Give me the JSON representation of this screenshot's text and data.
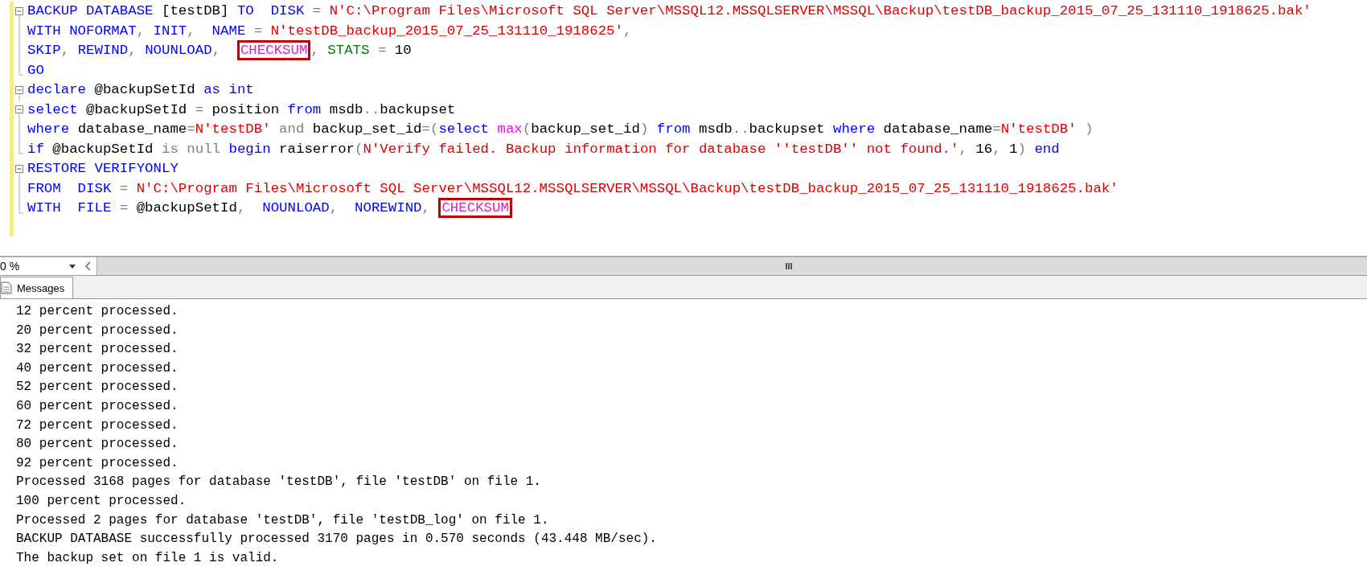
{
  "editor": {
    "lines": [
      {
        "kind": "block-start",
        "tokens": [
          {
            "kind": "kw",
            "text": "BACKUP DATABASE "
          },
          {
            "kind": "plain",
            "text": "[testDB] "
          },
          {
            "kind": "kw",
            "text": "TO  DISK "
          },
          {
            "kind": "op",
            "text": "= "
          },
          {
            "kind": "str",
            "text": "N'C:\\Program Files\\Microsoft SQL Server\\MSSQL12.MSSQLSERVER\\MSSQL\\Backup\\testDB_backup_2015_07_25_131110_1918625.bak'"
          }
        ]
      },
      {
        "kind": "block-body",
        "tokens": [
          {
            "kind": "kw",
            "text": "WITH NOFORMAT"
          },
          {
            "kind": "op",
            "text": ", "
          },
          {
            "kind": "kw",
            "text": "INIT"
          },
          {
            "kind": "op",
            "text": ",  "
          },
          {
            "kind": "kw",
            "text": "NAME "
          },
          {
            "kind": "op",
            "text": "= "
          },
          {
            "kind": "str",
            "text": "N'testDB_backup_2015_07_25_131110_1918625'"
          },
          {
            "kind": "op",
            "text": ","
          }
        ]
      },
      {
        "kind": "block-body",
        "tokens": [
          {
            "kind": "kw",
            "text": "SKIP"
          },
          {
            "kind": "op",
            "text": ", "
          },
          {
            "kind": "kw",
            "text": "REWIND"
          },
          {
            "kind": "op",
            "text": ", "
          },
          {
            "kind": "kw",
            "text": "NOUNLOAD"
          },
          {
            "kind": "op",
            "text": ",  "
          },
          {
            "kind": "fn",
            "text": "CHECKSUM",
            "boxed": true
          },
          {
            "kind": "op",
            "text": ", "
          },
          {
            "kind": "sys",
            "text": "STATS "
          },
          {
            "kind": "op",
            "text": "= "
          },
          {
            "kind": "plain",
            "text": "10"
          }
        ]
      },
      {
        "kind": "block-end",
        "tokens": [
          {
            "kind": "kw",
            "text": "GO"
          }
        ]
      },
      {
        "kind": "block-start",
        "tokens": [
          {
            "kind": "kw",
            "text": "declare "
          },
          {
            "kind": "plain",
            "text": "@backupSetId "
          },
          {
            "kind": "kw",
            "text": "as int"
          }
        ]
      },
      {
        "kind": "block-start",
        "tokens": [
          {
            "kind": "kw",
            "text": "select "
          },
          {
            "kind": "plain",
            "text": "@backupSetId "
          },
          {
            "kind": "op",
            "text": "= "
          },
          {
            "kind": "plain",
            "text": "position "
          },
          {
            "kind": "kw",
            "text": "from "
          },
          {
            "kind": "plain",
            "text": "msdb"
          },
          {
            "kind": "op",
            "text": ".."
          },
          {
            "kind": "plain",
            "text": "backupset"
          }
        ]
      },
      {
        "kind": "block-body",
        "tokens": [
          {
            "kind": "kw",
            "text": "where "
          },
          {
            "kind": "plain",
            "text": "database_name"
          },
          {
            "kind": "op",
            "text": "="
          },
          {
            "kind": "str",
            "text": "N'testDB'"
          },
          {
            "kind": "op",
            "text": " and "
          },
          {
            "kind": "plain",
            "text": "backup_set_id"
          },
          {
            "kind": "op",
            "text": "=("
          },
          {
            "kind": "kw",
            "text": "select "
          },
          {
            "kind": "fn",
            "text": "max"
          },
          {
            "kind": "op",
            "text": "("
          },
          {
            "kind": "plain",
            "text": "backup_set_id"
          },
          {
            "kind": "op",
            "text": ") "
          },
          {
            "kind": "kw",
            "text": "from "
          },
          {
            "kind": "plain",
            "text": "msdb"
          },
          {
            "kind": "op",
            "text": ".."
          },
          {
            "kind": "plain",
            "text": "backupset "
          },
          {
            "kind": "kw",
            "text": "where "
          },
          {
            "kind": "plain",
            "text": "database_name"
          },
          {
            "kind": "op",
            "text": "="
          },
          {
            "kind": "str",
            "text": "N'testDB'"
          },
          {
            "kind": "op",
            "text": " )"
          }
        ]
      },
      {
        "kind": "block-end",
        "tokens": [
          {
            "kind": "kw",
            "text": "if "
          },
          {
            "kind": "plain",
            "text": "@backupSetId "
          },
          {
            "kind": "op",
            "text": "is null "
          },
          {
            "kind": "kw",
            "text": "begin "
          },
          {
            "kind": "plain",
            "text": "raiserror"
          },
          {
            "kind": "op",
            "text": "("
          },
          {
            "kind": "str",
            "text": "N'Verify failed. Backup information for database ''testDB'' not found.'"
          },
          {
            "kind": "op",
            "text": ", "
          },
          {
            "kind": "plain",
            "text": "16"
          },
          {
            "kind": "op",
            "text": ", "
          },
          {
            "kind": "plain",
            "text": "1"
          },
          {
            "kind": "op",
            "text": ") "
          },
          {
            "kind": "kw",
            "text": "end"
          }
        ]
      },
      {
        "kind": "block-start",
        "tokens": [
          {
            "kind": "kw",
            "text": "RESTORE VERIFYONLY"
          }
        ]
      },
      {
        "kind": "block-body",
        "tokens": [
          {
            "kind": "kw",
            "text": "FROM  DISK "
          },
          {
            "kind": "op",
            "text": "= "
          },
          {
            "kind": "str",
            "text": "N'C:\\Program Files\\Microsoft SQL Server\\MSSQL12.MSSQLSERVER\\MSSQL\\Backup\\testDB_backup_2015_07_25_131110_1918625.bak'"
          }
        ]
      },
      {
        "kind": "block-end",
        "tokens": [
          {
            "kind": "kw",
            "text": "WITH  FILE "
          },
          {
            "kind": "op",
            "text": "= "
          },
          {
            "kind": "plain",
            "text": "@backupSetId"
          },
          {
            "kind": "op",
            "text": ",  "
          },
          {
            "kind": "kw",
            "text": "NOUNLOAD"
          },
          {
            "kind": "op",
            "text": ",  "
          },
          {
            "kind": "kw",
            "text": "NOREWIND"
          },
          {
            "kind": "op",
            "text": ", "
          },
          {
            "kind": "fn",
            "text": "CHECKSUM",
            "boxed": true
          }
        ]
      }
    ]
  },
  "zoom": {
    "value": "0 %"
  },
  "tabs": [
    {
      "label": "Messages",
      "selected": true
    }
  ],
  "messages": [
    "12 percent processed.",
    "20 percent processed.",
    "32 percent processed.",
    "40 percent processed.",
    "52 percent processed.",
    "60 percent processed.",
    "72 percent processed.",
    "80 percent processed.",
    "92 percent processed.",
    "Processed 3168 pages for database 'testDB', file 'testDB' on file 1.",
    "100 percent processed.",
    "Processed 2 pages for database 'testDB', file 'testDB_log' on file 1.",
    "BACKUP DATABASE successfully processed 3170 pages in 0.570 seconds (43.448 MB/sec).",
    "The backup set on file 1 is valid."
  ]
}
